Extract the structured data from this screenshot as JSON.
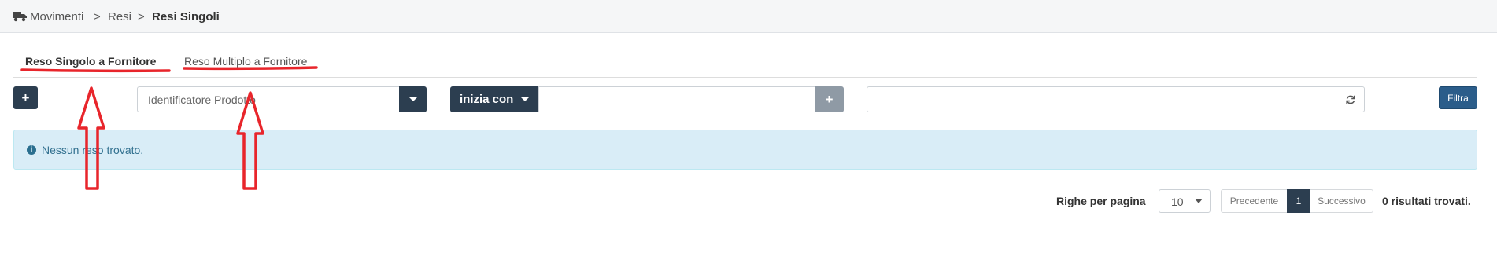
{
  "breadcrumb": {
    "icon": "truck-icon",
    "items": [
      "Movimenti",
      "Resi",
      "Resi Singoli"
    ],
    "separator": ">"
  },
  "tabs": [
    {
      "label": "Reso Singolo a Fornitore",
      "active": true
    },
    {
      "label": "Reso Multiplo a Fornitore",
      "active": false
    }
  ],
  "filters": {
    "add_label": "+",
    "product_placeholder": "Identificatore Prodotto",
    "match_mode": "inizia con",
    "value_placeholder": "",
    "add_filter_label": "+",
    "search_placeholder": "",
    "filter_button": "Filtra"
  },
  "alert": {
    "icon": "info-icon",
    "text": "Nessun reso trovato."
  },
  "pagination": {
    "rows_label": "Righe per pagina",
    "rows_value": "10",
    "prev": "Precedente",
    "page": "1",
    "next": "Successivo",
    "results": "0 risultati trovati."
  },
  "colors": {
    "primary_dark": "#2c3e50",
    "filter_blue": "#2b5d8a",
    "alert_bg": "#d9edf7",
    "annotation_red": "#e8252b"
  }
}
